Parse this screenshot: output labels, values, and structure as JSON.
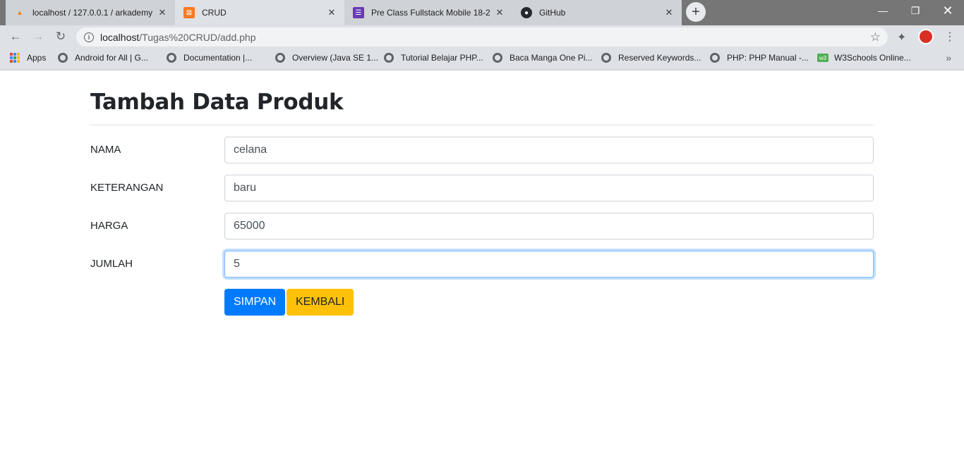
{
  "browser": {
    "tabs": [
      {
        "title": "localhost / 127.0.0.1 / arkademy |",
        "icon": "phpmyadmin-icon",
        "active": false
      },
      {
        "title": "CRUD",
        "icon": "xampp-icon",
        "active": true
      },
      {
        "title": "Pre Class Fullstack Mobile 18-2",
        "icon": "forms-icon",
        "active": false
      },
      {
        "title": "GitHub",
        "icon": "github-icon",
        "active": false
      }
    ],
    "url_host": "localhost",
    "url_path": "/Tugas%20CRUD/add.php",
    "bookmarks": [
      {
        "label": "Apps"
      },
      {
        "label": "Android for All  |  G..."
      },
      {
        "label": "Documentation  |..."
      },
      {
        "label": "Overview (Java SE 1..."
      },
      {
        "label": "Tutorial Belajar PHP..."
      },
      {
        "label": "Baca Manga One Pi..."
      },
      {
        "label": "Reserved Keywords..."
      },
      {
        "label": "PHP: PHP Manual -..."
      },
      {
        "label": "W3Schools Online..."
      }
    ]
  },
  "page": {
    "title": "Tambah Data Produk",
    "fields": [
      {
        "label": "NAMA",
        "value": "celana"
      },
      {
        "label": "KETERANGAN",
        "value": "baru"
      },
      {
        "label": "HARGA",
        "value": "65000"
      },
      {
        "label": "JUMLAH",
        "value": "5"
      }
    ],
    "save_label": "SIMPAN",
    "back_label": "KEMBALI"
  },
  "colors": {
    "primary": "#007bff",
    "warning": "#ffc107",
    "text": "#212529"
  }
}
